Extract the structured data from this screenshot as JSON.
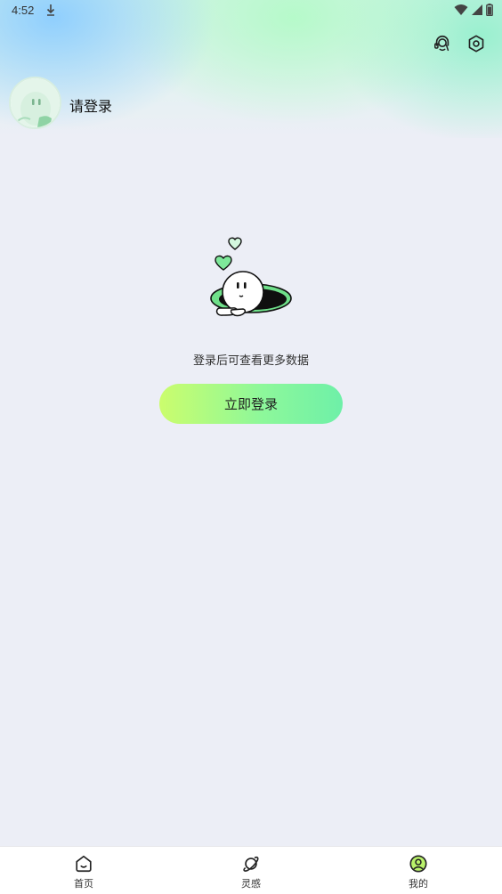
{
  "status_bar": {
    "time": "4:52",
    "icons": [
      "download-icon",
      "wifi-icon",
      "signal-icon",
      "battery-icon"
    ]
  },
  "header": {
    "icons": [
      "customer-service-icon",
      "settings-icon"
    ],
    "login_prompt": "请登录"
  },
  "main": {
    "hint": "登录后可查看更多数据",
    "login_button": "立即登录"
  },
  "bottom_nav": {
    "items": [
      {
        "label": "首页",
        "icon": "home-icon"
      },
      {
        "label": "灵感",
        "icon": "planet-icon"
      },
      {
        "label": "我的",
        "icon": "profile-icon",
        "active": true
      }
    ]
  },
  "colors": {
    "accent_start": "#cbfd6d",
    "accent_end": "#6ef0a8",
    "background": "#ECEEF6",
    "active_icon": "#b9f26a"
  }
}
